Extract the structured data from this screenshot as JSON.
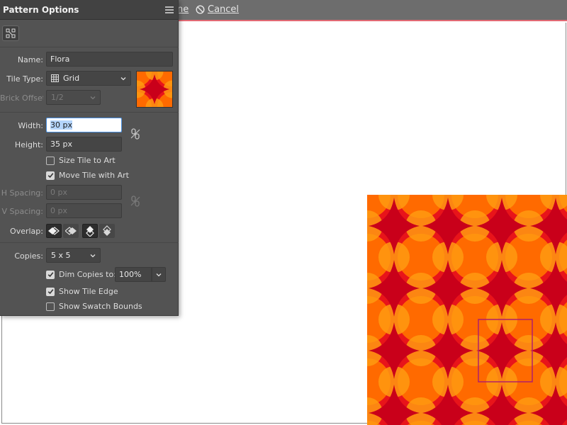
{
  "topbar": {
    "done_label": "ne",
    "cancel_label": "Cancel"
  },
  "panel": {
    "title": "Pattern Options",
    "name_label": "Name:",
    "name_value": "Flora",
    "tile_type_label": "Tile Type:",
    "tile_type_value": "Grid",
    "brick_offset_label": "Brick Offset:",
    "brick_offset_value": "1/2",
    "width_label": "Width:",
    "width_value": "30 px",
    "height_label": "Height:",
    "height_value": "35 px",
    "size_tile_label": "Size Tile to Art",
    "size_tile_checked": false,
    "move_tile_label": "Move Tile with Art",
    "move_tile_checked": true,
    "h_spacing_label": "H Spacing:",
    "h_spacing_value": "0 px",
    "v_spacing_label": "V Spacing:",
    "v_spacing_value": "0 px",
    "overlap_label": "Overlap:",
    "copies_label": "Copies:",
    "copies_value": "5 x 5",
    "dim_copies_label": "Dim Copies to:",
    "dim_copies_checked": true,
    "dim_copies_value": "100%",
    "show_tile_edge_label": "Show Tile Edge",
    "show_tile_edge_checked": true,
    "show_swatch_bounds_label": "Show Swatch Bounds",
    "show_swatch_bounds_checked": false
  },
  "colors": {
    "pattern_dark_red": "#c9001a",
    "pattern_red": "#e8141a",
    "pattern_orange": "#ff6a00",
    "pattern_light_orange": "#ff9a10",
    "tile_edge": "#b0206a"
  },
  "icons": {
    "panel_menu": "hamburger-menu-icon",
    "pattern_tile_tool": "pattern-tile-tool-icon",
    "grid": "grid-icon",
    "link": "chain-link-icon",
    "cancel": "cancel-circle-icon"
  }
}
